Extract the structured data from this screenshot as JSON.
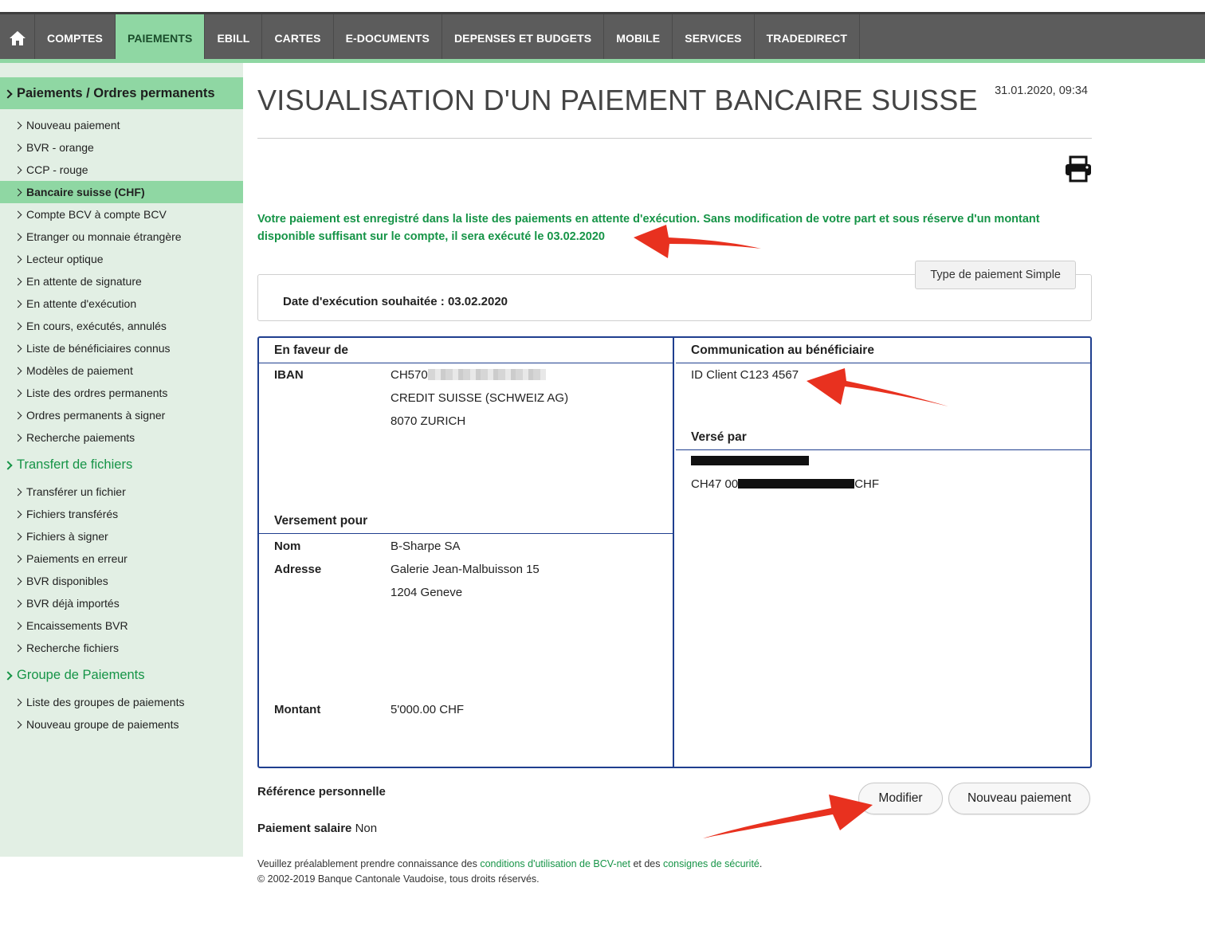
{
  "nav": {
    "home_icon": "home-icon",
    "tabs": [
      {
        "label": "COMPTES"
      },
      {
        "label": "PAIEMENTS",
        "active": true
      },
      {
        "label": "EBILL"
      },
      {
        "label": "CARTES"
      },
      {
        "label": "E-DOCUMENTS"
      },
      {
        "label": "DEPENSES ET BUDGETS"
      },
      {
        "label": "MOBILE"
      },
      {
        "label": "SERVICES"
      },
      {
        "label": "TRADEDIRECT"
      }
    ]
  },
  "sidebar": {
    "section1": {
      "label": "Paiements / Ordres permanents",
      "items": [
        "Nouveau paiement",
        "BVR - orange",
        "CCP - rouge",
        "Bancaire suisse (CHF)",
        "Compte BCV à compte BCV",
        "Etranger ou monnaie étrangère",
        "Lecteur optique",
        "En attente de signature",
        "En attente d'exécution",
        "En cours, exécutés, annulés",
        "Liste de bénéficiaires connus",
        "Modèles de paiement",
        "Liste des ordres permanents",
        "Ordres permanents à signer",
        "Recherche paiements"
      ]
    },
    "section2": {
      "label": "Transfert de fichiers",
      "items": [
        "Transférer un fichier",
        "Fichiers transférés",
        "Fichiers à signer",
        "Paiements en erreur",
        "BVR disponibles",
        "BVR déjà importés",
        "Encaissements BVR",
        "Recherche fichiers"
      ]
    },
    "section3": {
      "label": "Groupe de Paiements",
      "items": [
        "Liste des groupes de paiements",
        "Nouveau groupe de paiements"
      ]
    }
  },
  "main": {
    "title": "VISUALISATION D'UN PAIEMENT BANCAIRE SUISSE",
    "timestamp": "31.01.2020, 09:34",
    "print_icon": "printer-icon",
    "notice": "Votre paiement est enregistré dans la liste des paiements en attente d'exécution. Sans modification de votre part et sous réserve d'un montant disponible suffisant sur le compte, il sera exécuté le 03.02.2020",
    "execution_date": "Date d'exécution souhaitée : 03.02.2020",
    "payment_type_button": "Type de paiement Simple",
    "beneficiary": {
      "header": "En faveur de",
      "iban_label": "IBAN",
      "iban_value": "CH570",
      "bank_name": "CREDIT SUISSE (SCHWEIZ AG)",
      "bank_city": "8070 ZURICH"
    },
    "payment_for": {
      "header": "Versement pour",
      "name_label": "Nom",
      "name_value": "B-Sharpe SA",
      "address_label": "Adresse",
      "address_line1": "Galerie Jean-Malbuisson 15",
      "address_line2": "1204 Geneve",
      "amount_label": "Montant",
      "amount_value": "5'000.00 CHF"
    },
    "communication": {
      "header": "Communication au bénéficiaire",
      "value": "ID Client C123 4567"
    },
    "paid_by": {
      "header": "Versé par",
      "account_prefix": "CH47 00",
      "account_suffix": "CHF"
    },
    "personal_reference_label": "Référence personnelle",
    "salary_label": "Paiement salaire",
    "salary_value": "Non",
    "modify_button": "Modifier",
    "new_payment_button": "Nouveau paiement"
  },
  "footer": {
    "text_before": "Veuillez préalablement prendre connaissance des ",
    "link1": "conditions d'utilisation de BCV-net",
    "text_middle": " et des ",
    "link2": "consignes de sécurité",
    "text_after": ".",
    "copyright": "© 2002-2019 Banque Cantonale Vaudoise, tous droits réservés."
  },
  "colors": {
    "nav_bg": "#5c5c5c",
    "accent_green": "#8fd7a3",
    "text_green": "#169447",
    "sidebar_bg": "#e2efe4",
    "frame_blue": "#1f3f8f",
    "annotation_red": "#e8311f"
  }
}
